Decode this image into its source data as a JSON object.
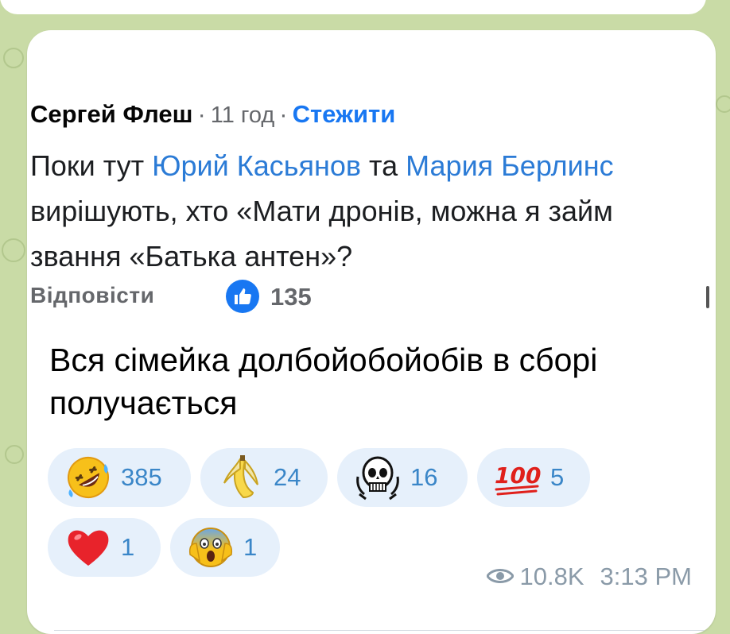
{
  "comment_screenshot": {
    "author": "Сергей Флеш",
    "separator": "·",
    "time_ago": "11 год",
    "follow_label": "Стежити",
    "line1_a": "Поки тут ",
    "mention1": "Юрий Касьянов",
    "line1_b": " та ",
    "mention2": "Мария Берлинс",
    "line2": "вирішують, хто «Мати дронів, можна я займ",
    "line3": "звання «Батька антен»?",
    "reply_label": "Відповісти",
    "like_count": "135"
  },
  "message": {
    "text": "Вся сімейка долбойобойобів в сборі получається"
  },
  "reactions": [
    {
      "icon": "rofl-emoji",
      "count": "385"
    },
    {
      "icon": "banana-emoji",
      "count": "24"
    },
    {
      "icon": "skull-emblem-emoji",
      "count": "16"
    },
    {
      "icon": "hundred-points-emoji",
      "count": "5"
    },
    {
      "icon": "red-heart-emoji",
      "count": "1"
    },
    {
      "icon": "screaming-face-emoji",
      "count": "1"
    }
  ],
  "footer": {
    "view_icon": "eye-icon",
    "views": "10.8K",
    "time": "3:13 PM"
  },
  "colors": {
    "wallpaper": "#c9dba6",
    "reaction_bg": "#e6f0fb",
    "reaction_text": "#3a86c8",
    "facebook_blue": "#1877f2"
  }
}
